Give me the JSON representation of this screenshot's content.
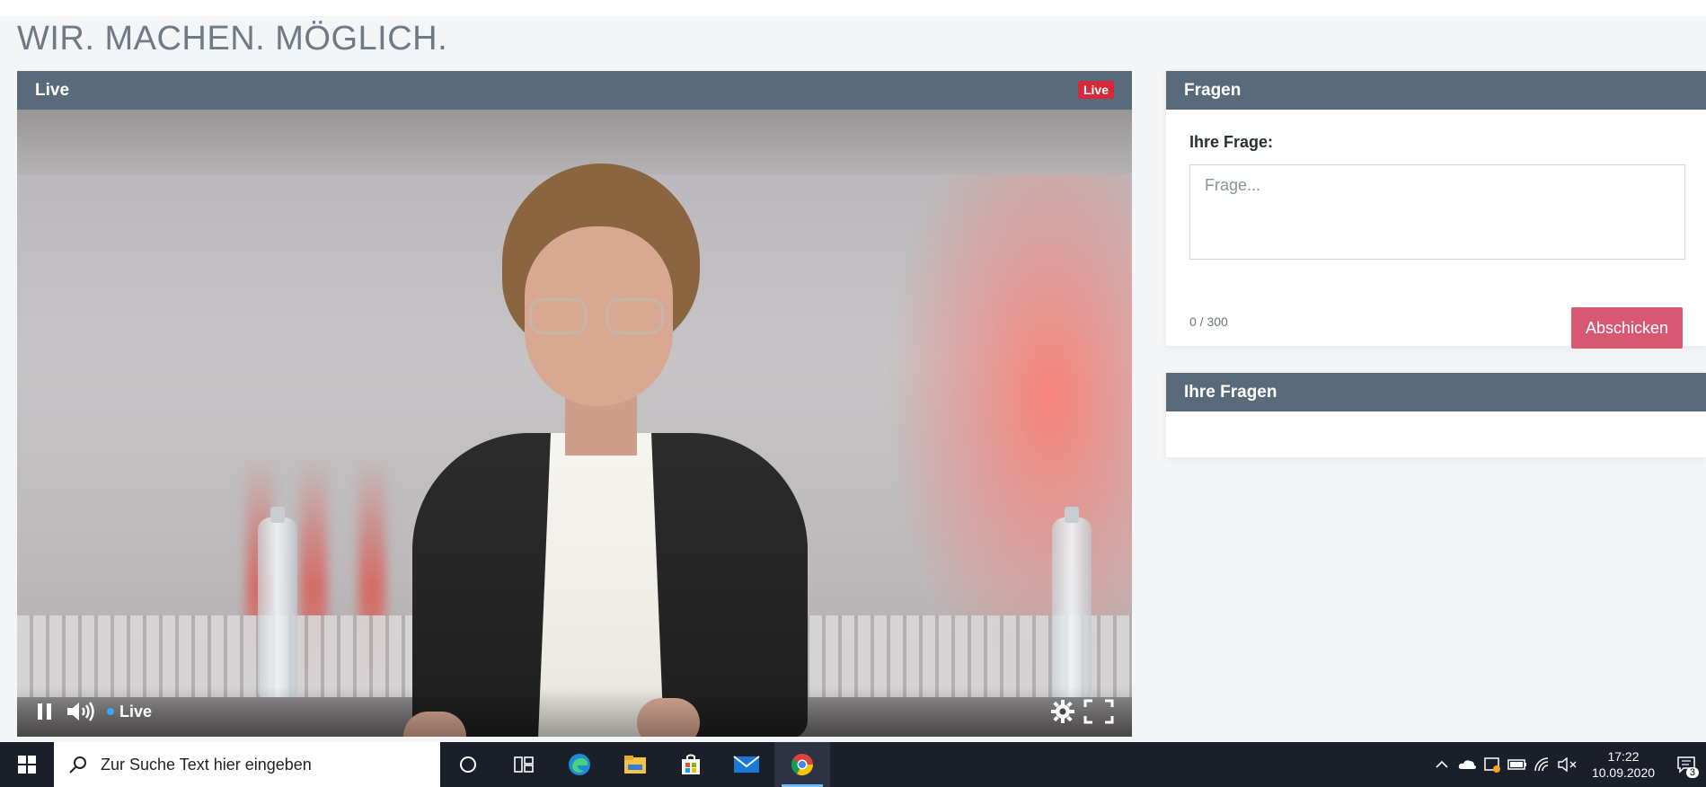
{
  "page": {
    "title": "WIR. MACHEN. MÖGLICH."
  },
  "video": {
    "header_title": "Live",
    "badge": "Live",
    "controls": {
      "live_label": "Live",
      "icons": [
        "pause-icon",
        "volume-icon",
        "settings-icon",
        "fullscreen-icon"
      ]
    }
  },
  "questions": {
    "header_title": "Fragen",
    "label": "Ihre Frage:",
    "placeholder": "Frage...",
    "counter": "0 / 300",
    "submit_label": "Abschicken"
  },
  "my_questions": {
    "header_title": "Ihre Fragen"
  },
  "taskbar": {
    "search_placeholder": "Zur Suche Text hier eingeben",
    "time": "17:22",
    "date": "10.09.2020",
    "notification_count": "3",
    "apps": [
      "cortana-icon",
      "task-view-icon",
      "edge-icon",
      "file-explorer-icon",
      "store-icon",
      "mail-icon",
      "chrome-icon"
    ]
  },
  "colors": {
    "header_bg": "#596b7b",
    "live_badge": "#d6283b",
    "submit_button": "#d65872",
    "title_text": "#6f7a85",
    "taskbar": "#1b1f2a"
  }
}
